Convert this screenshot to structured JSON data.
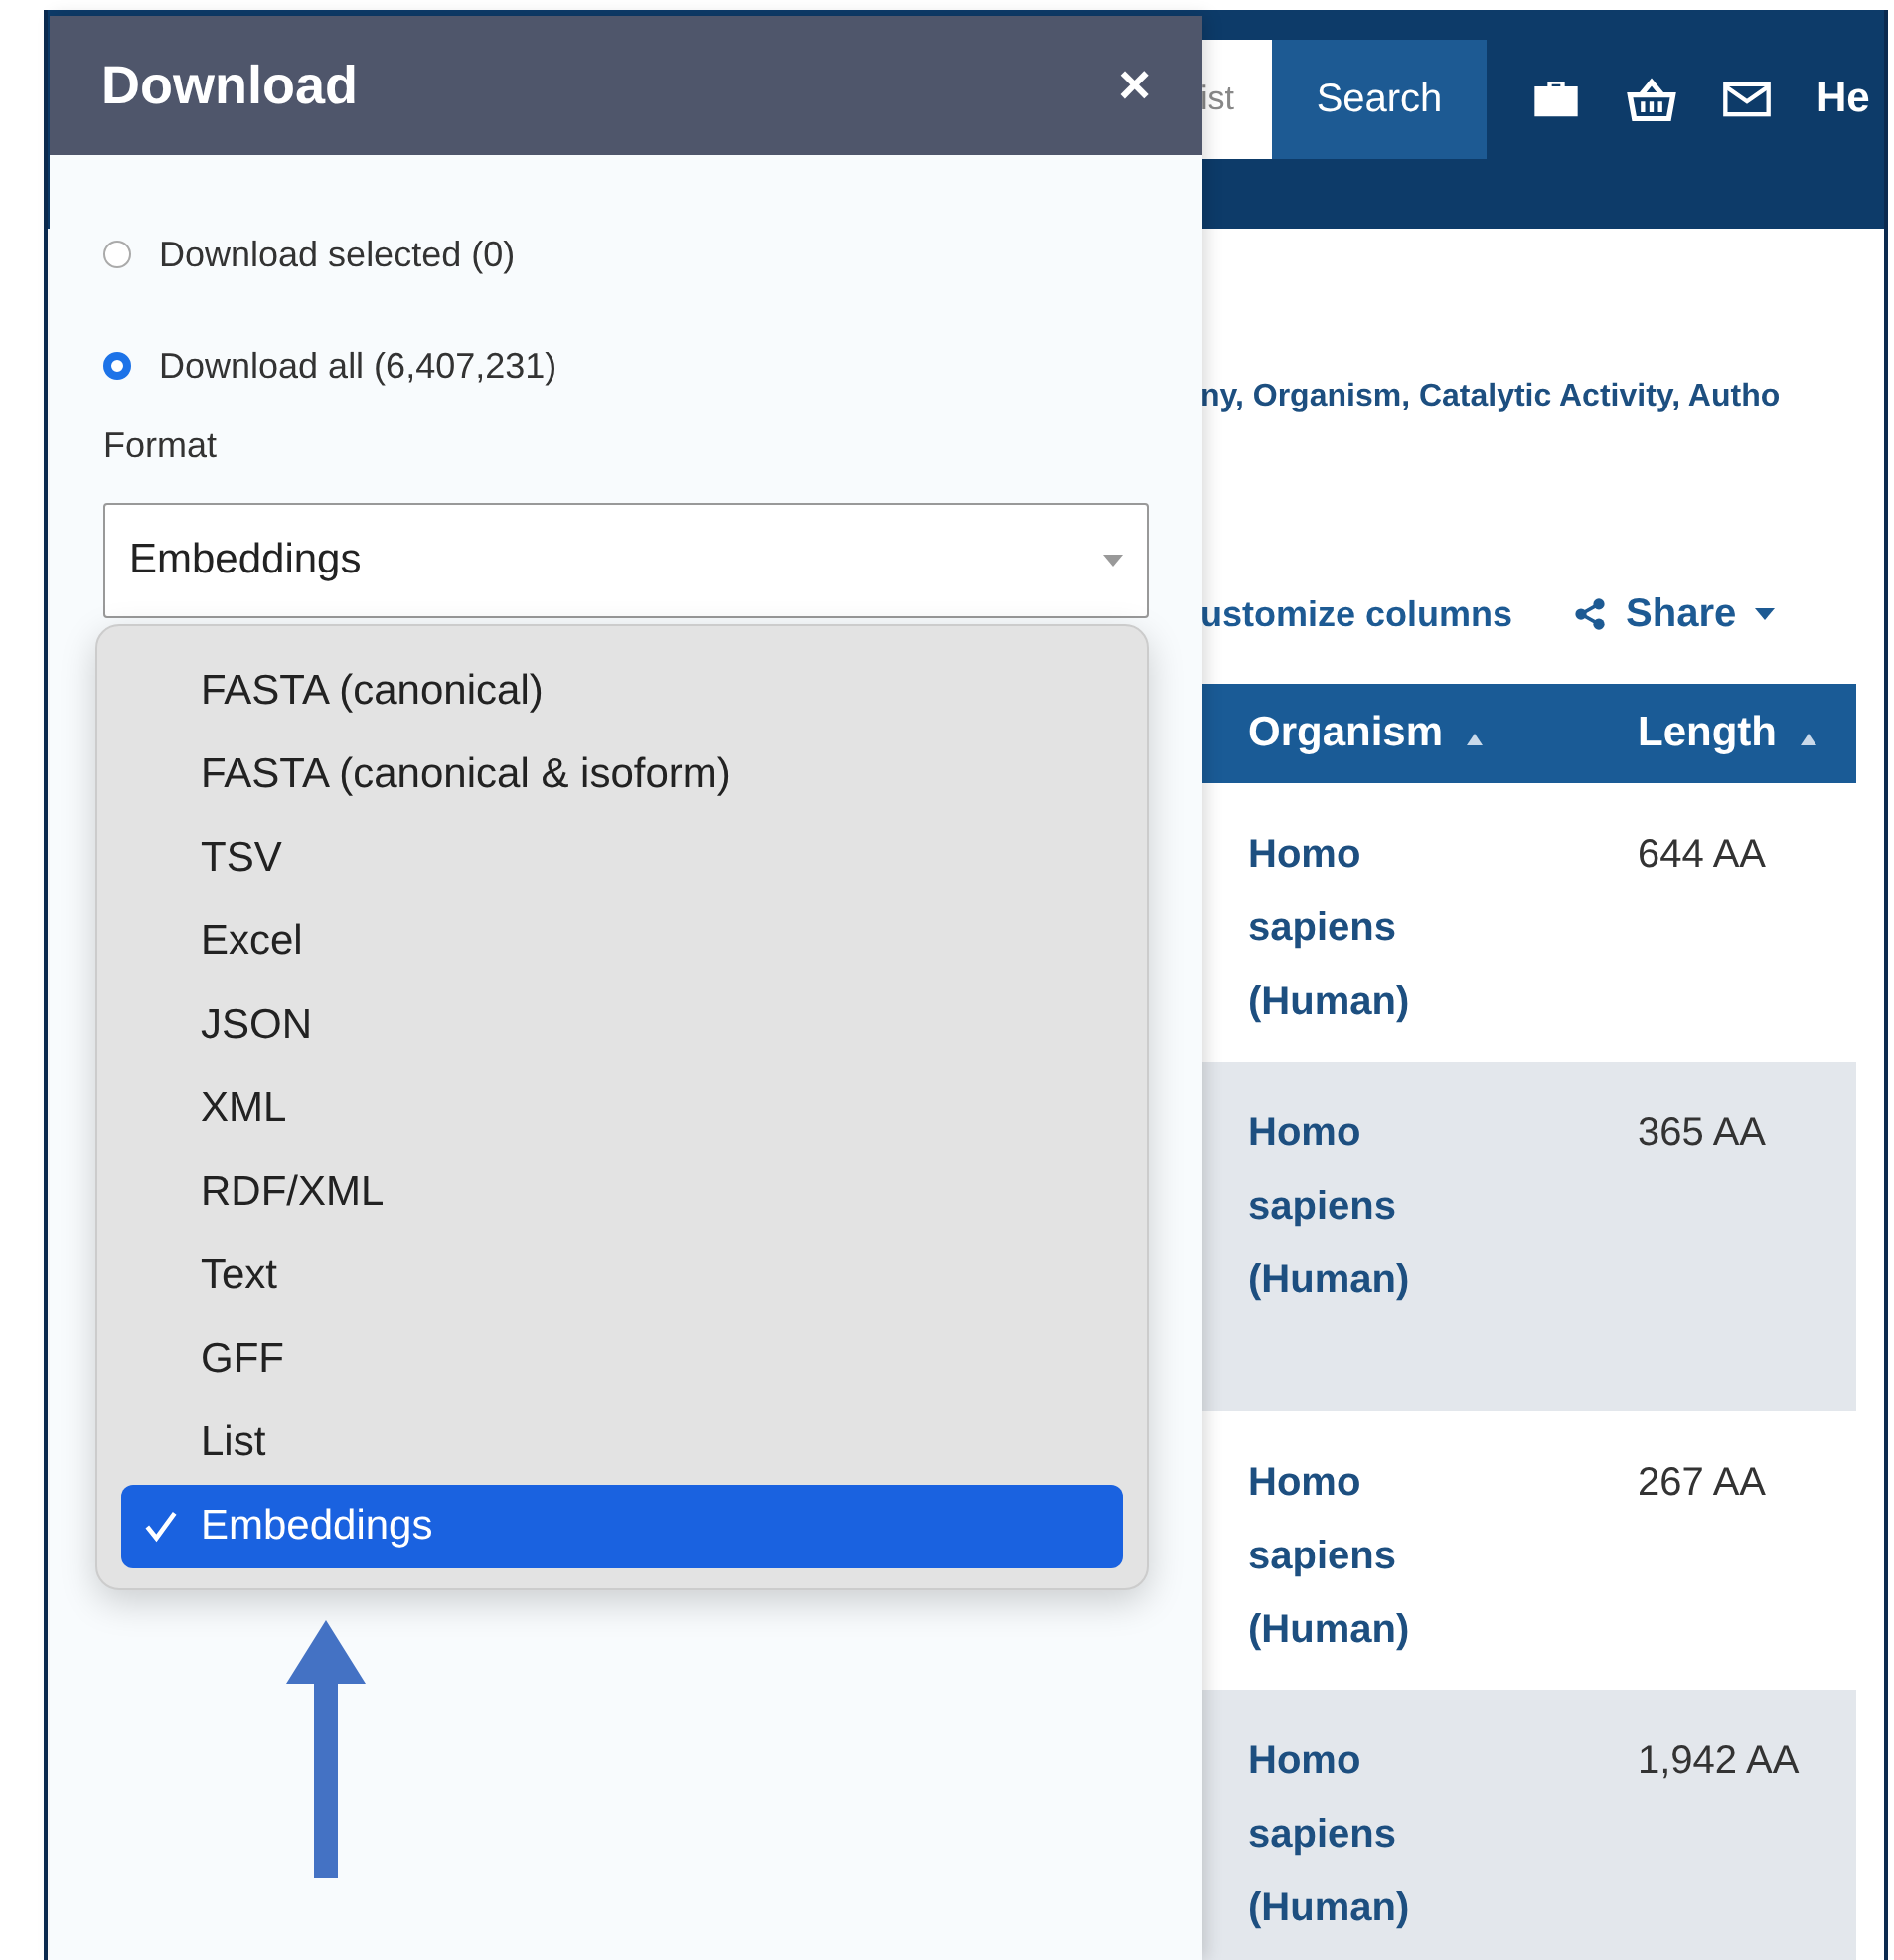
{
  "window": {
    "title": "Download",
    "close": "×"
  },
  "navbar": {
    "search_value": "ist",
    "search_button": "Search",
    "link": "He"
  },
  "filter_text": "ny, Organism, Catalytic Activity, Autho",
  "toolbar": {
    "customize": "ustomize columns",
    "share": "Share"
  },
  "download_options": [
    {
      "label": "Download selected (0)",
      "selected": false
    },
    {
      "label": "Download all (6,407,231)",
      "selected": true
    }
  ],
  "format": {
    "label": "Format",
    "value": "Embeddings",
    "expanded": true,
    "options": [
      {
        "label": "FASTA (canonical)",
        "selected": false
      },
      {
        "label": "FASTA (canonical & isoform)",
        "selected": false
      },
      {
        "label": "TSV",
        "selected": false
      },
      {
        "label": "Excel",
        "selected": false
      },
      {
        "label": "JSON",
        "selected": false
      },
      {
        "label": "XML",
        "selected": false
      },
      {
        "label": "RDF/XML",
        "selected": false
      },
      {
        "label": "Text",
        "selected": false
      },
      {
        "label": "GFF",
        "selected": false
      },
      {
        "label": "List",
        "selected": false
      },
      {
        "label": "Embeddings",
        "selected": true
      }
    ]
  },
  "table": {
    "columns": [
      "Organism",
      "Length"
    ],
    "rows": [
      {
        "organism": "Homo sapiens (Human)",
        "length": "644 AA"
      },
      {
        "organism": "Homo sapiens (Human)",
        "length": "365 AA"
      },
      {
        "organism": "Homo sapiens (Human)",
        "length": "267 AA"
      },
      {
        "organism": "Homo sapiens (Human)",
        "length": "1,942 AA"
      }
    ]
  }
}
